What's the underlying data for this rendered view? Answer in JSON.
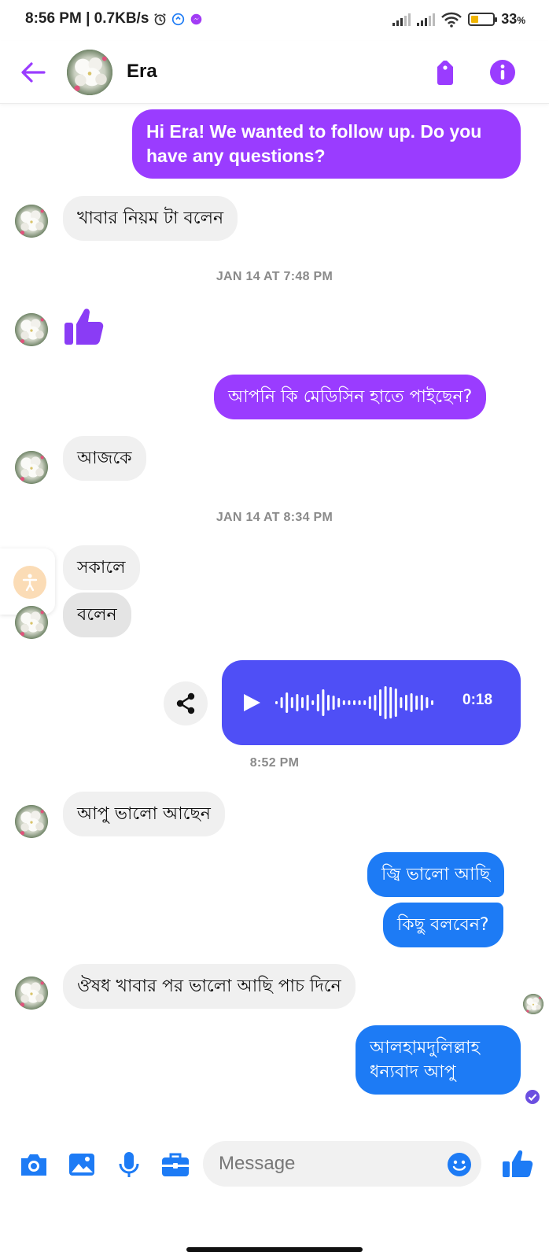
{
  "status_bar": {
    "time_speed": "8:56 PM | 0.7KB/s",
    "battery_percent": "33",
    "battery_unit": "%",
    "battery_level": 0.33
  },
  "header": {
    "contact_name": "Era"
  },
  "colors": {
    "accent_purple": "#9a3cff",
    "accent_blue": "#1d7bf5",
    "audio_bubble": "#4f4ff6"
  },
  "messages": {
    "m1": "Hi Era! We wanted to follow up. Do you have any questions?",
    "m2": "খাবার নিয়ম টা বলেন",
    "ts1": "JAN 14 AT 7:48 PM",
    "m3_icon": "thumbs-up-icon",
    "m4": "আপনি কি মেডিসিন হাতে পাইছেন?",
    "m5": "আজকে",
    "ts2": "JAN 14 AT 8:34 PM",
    "m6": "সকালে",
    "m7": "বলেন",
    "audio_duration": "0:18",
    "ts3": "8:52 PM",
    "m8": "আপু ভালো আছেন",
    "m9": "জ্বি ভালো আছি",
    "m10": "কিছু বলবেন?",
    "m11": "ঔষধ খাবার পর ভালো আছি পাচ দিনে",
    "m12_line1": "আলহামদুলিল্লাহ",
    "m12_line2": "ধন্যবাদ আপু"
  },
  "composer": {
    "placeholder": "Message"
  }
}
